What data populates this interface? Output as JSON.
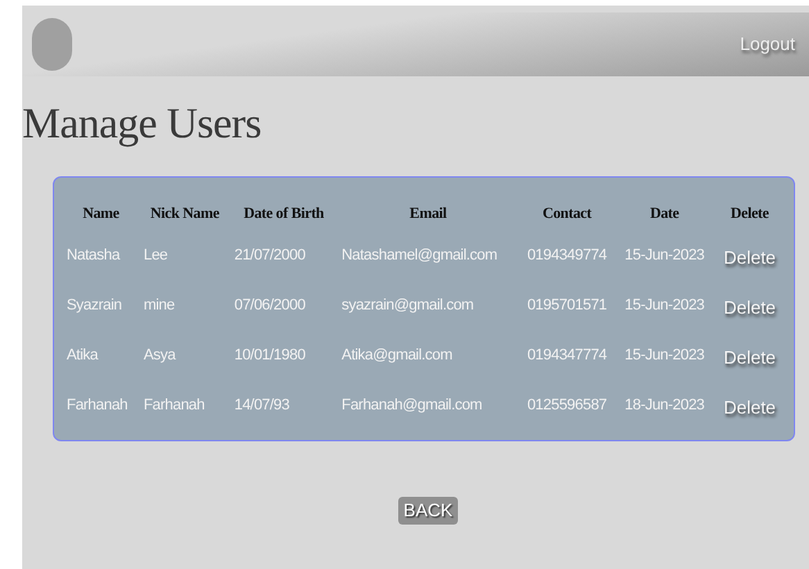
{
  "header": {
    "logout": "Logout"
  },
  "title": "Manage Users",
  "table": {
    "columns": [
      "Name",
      "Nick Name",
      "Date of Birth",
      "Email",
      "Contact",
      "Date",
      "Delete"
    ],
    "rows": [
      {
        "cells": [
          "Natasha",
          "Lee",
          "21/07/2000",
          "Natashamel@gmail.com",
          "0194349774",
          "15-Jun-2023"
        ],
        "action": "Delete"
      },
      {
        "cells": [
          "Syazrain",
          "mine",
          "07/06/2000",
          "syazrain@gmail.com",
          "0195701571",
          "15-Jun-2023"
        ],
        "action": "Delete"
      },
      {
        "cells": [
          "Atika",
          "Asya",
          "10/01/1980",
          "Atika@gmail.com",
          "0194347774",
          "15-Jun-2023"
        ],
        "action": "Delete"
      },
      {
        "cells": [
          "Farhanah",
          "Farhanah",
          "14/07/93",
          "Farhanah@gmail.com",
          "0125596587",
          "18-Jun-2023"
        ],
        "action": "Delete"
      }
    ]
  },
  "back": "BACK"
}
